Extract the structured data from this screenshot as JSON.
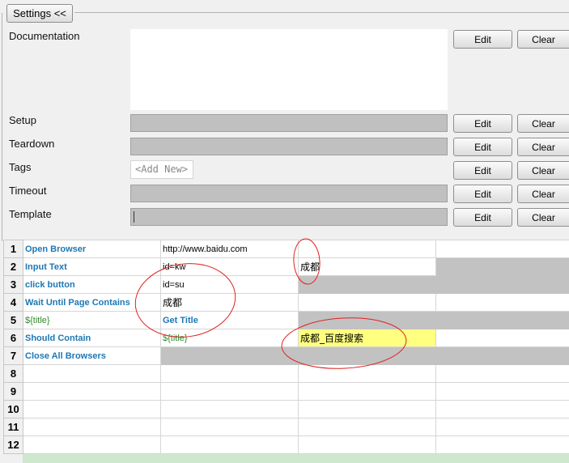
{
  "settings": {
    "toggle_label": "Settings <<",
    "documentation": {
      "label": "Documentation",
      "value": ""
    },
    "buttons": {
      "edit": "Edit",
      "clear": "Clear"
    },
    "fields": [
      {
        "label": "Setup",
        "value": ""
      },
      {
        "label": "Teardown",
        "value": ""
      },
      {
        "label": "Tags",
        "placeholder": "<Add New>"
      },
      {
        "label": "Timeout",
        "value": ""
      },
      {
        "label": "Template",
        "value": ""
      }
    ]
  },
  "grid": {
    "rows": [
      {
        "num": "1",
        "cells": [
          "Open Browser",
          "http://www.baidu.com",
          "",
          ""
        ]
      },
      {
        "num": "2",
        "cells": [
          "Input Text",
          "id=kw",
          "成都",
          ""
        ]
      },
      {
        "num": "3",
        "cells": [
          "click button",
          "id=su",
          "",
          ""
        ]
      },
      {
        "num": "4",
        "cells": [
          "Wait Until Page Contains",
          "成都",
          "",
          ""
        ]
      },
      {
        "num": "5",
        "cells": [
          "${title}",
          "Get Title",
          "",
          ""
        ]
      },
      {
        "num": "6",
        "cells": [
          "Should Contain",
          "${title}",
          "成都_百度搜索",
          ""
        ]
      },
      {
        "num": "7",
        "cells": [
          "Close All Browsers",
          "",
          "",
          ""
        ]
      },
      {
        "num": "8",
        "cells": [
          "",
          "",
          "",
          ""
        ]
      },
      {
        "num": "9",
        "cells": [
          "",
          "",
          "",
          ""
        ]
      },
      {
        "num": "10",
        "cells": [
          "",
          "",
          "",
          ""
        ]
      },
      {
        "num": "11",
        "cells": [
          "",
          "",
          "",
          ""
        ]
      },
      {
        "num": "12",
        "cells": [
          "",
          "",
          "",
          ""
        ]
      }
    ]
  },
  "colors": {
    "keyword": "#1e78b4",
    "variable": "#2f8a2f",
    "highlight": "#ffff80",
    "annotation": "#e0201e"
  }
}
